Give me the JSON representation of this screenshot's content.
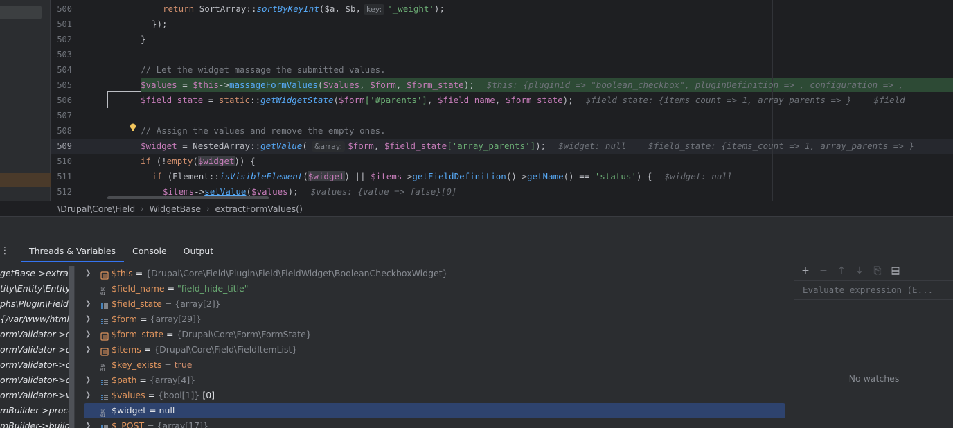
{
  "editor": {
    "line_numbers": [
      "500",
      "501",
      "502",
      "503",
      "504",
      "505",
      "506",
      "507",
      "508",
      "509",
      "510",
      "511",
      "512"
    ],
    "lines": {
      "l500": {
        "return": "return",
        "cls": "SortArray::",
        "fn": "sortByKeyInt",
        "args": "($a, $b,",
        "chip": "key:",
        "str": "'_weight'",
        "end": ");"
      },
      "l501": {
        "text": "});"
      },
      "l502": {
        "text": "}"
      },
      "l504": {
        "comment": "// Let the widget massage the submitted values."
      },
      "l505": {
        "var1": "$values",
        "eq": " = ",
        "var2": "$this",
        "arrow": "->",
        "fn": "massageFormValues",
        "args_open": "(",
        "a1": "$values",
        "c1": ", ",
        "a2": "$form",
        "c2": ", ",
        "a3": "$form_state",
        "end": ");",
        "hint": "$this: {pluginId => \"boolean_checkbox\", pluginDefinition => , configuration => ,"
      },
      "l506": {
        "var1": "$field_state",
        "eq": " = ",
        "kw": "static",
        "cls": "::",
        "fn": "getWidgetState",
        "open": "(",
        "a1": "$form",
        "s1": "['#parents']",
        "c1": ", ",
        "a2": "$field_name",
        "c2": ", ",
        "a3": "$form_state",
        "end": ");",
        "hint": "$field_state: {items_count => 1, array_parents => }",
        "hint2": "$field"
      },
      "l508": {
        "comment": "// Assign the values and remove the empty ones."
      },
      "l509": {
        "var1": "$widget",
        "eq": " = ",
        "cls": "NestedArray::",
        "fn": "getValue",
        "open": "(",
        "chip": "&array:",
        "a1": "$form",
        "c1": ", ",
        "a2": "$field_state",
        "s1": "['array_parents']",
        "end": ");",
        "hint": "$widget: null",
        "hint2": "$field_state: {items_count => 1, array_parents => }"
      },
      "l510": {
        "kw": "if",
        "open": " (!",
        "fn": "empty",
        "paren": "(",
        "a1": "$widget",
        "end": ")) {"
      },
      "l511": {
        "kw": "if",
        "open": " (",
        "cls": "Element::",
        "fn": "isVisibleElement",
        "paren": "(",
        "a1": "$widget",
        "mid": ") || ",
        "a2": "$items",
        "arrow": "->",
        "fn2": "getFieldDefinition",
        "mid2": "()->",
        "fn3": "getName",
        "mid3": "() == ",
        "str": "'status'",
        "end": ") {",
        "hint": "$widget: null"
      },
      "l512": {
        "a1": "$items",
        "arrow": "->",
        "fn": "setValue",
        "open": "(",
        "a2": "$values",
        "end": ");",
        "hint": "$values: {value => false}[0]"
      }
    }
  },
  "breadcrumb": [
    "\\Drupal\\Core\\Field",
    "WidgetBase",
    "extractFormValues()"
  ],
  "debug": {
    "tabs": [
      "Threads & Variables",
      "Console",
      "Output"
    ],
    "frames": [
      "getBase->extracti",
      "tity\\Entity\\EntityFo",
      "phs\\Plugin\\Field\\",
      "{/var/www/html/",
      "ormValidator->do",
      "ormValidator->do",
      "ormValidator->do",
      "ormValidator->do",
      "ormValidator->vali",
      "mBuilder->proces",
      "mBuilder->buildF"
    ],
    "variables": [
      {
        "name": "$this",
        "type": "{Drupal\\Core\\Field\\Plugin\\Field\\FieldWidget\\BooleanCheckboxWidget}",
        "value": "",
        "icon": "object",
        "expandable": true
      },
      {
        "name": "$field_name",
        "type": "",
        "value": "\"field_hide_title\"",
        "icon": "primitive",
        "expandable": false,
        "value_kind": "string"
      },
      {
        "name": "$field_state",
        "type": "{array[2]}",
        "value": "",
        "icon": "array",
        "expandable": true
      },
      {
        "name": "$form",
        "type": "{array[29]}",
        "value": "",
        "icon": "array",
        "expandable": true
      },
      {
        "name": "$form_state",
        "type": "{Drupal\\Core\\Form\\FormState}",
        "value": "",
        "icon": "object",
        "expandable": true
      },
      {
        "name": "$items",
        "type": "{Drupal\\Core\\Field\\FieldItemList}",
        "value": "",
        "icon": "object",
        "expandable": true
      },
      {
        "name": "$key_exists",
        "type": "",
        "value": "true",
        "icon": "primitive",
        "expandable": false,
        "value_kind": "keyword"
      },
      {
        "name": "$path",
        "type": "{array[4]}",
        "value": "",
        "icon": "array",
        "expandable": true
      },
      {
        "name": "$values",
        "type": "{bool[1]}",
        "value": "[0]",
        "icon": "array",
        "expandable": true,
        "value_kind": "plain"
      },
      {
        "name": "$widget",
        "type": "",
        "value": "null",
        "icon": "primitive",
        "expandable": false,
        "selected": true,
        "value_kind": "plain"
      },
      {
        "name": "$_POST",
        "type": "{array[17]}",
        "value": "",
        "icon": "array",
        "expandable": true
      }
    ],
    "watches": {
      "placeholder": "Evaluate expression (E...",
      "empty_text": "No watches"
    }
  },
  "colors": {
    "accent": "#3574f0",
    "exec_line": "#2d4a35",
    "selected_row": "#2e436e"
  }
}
